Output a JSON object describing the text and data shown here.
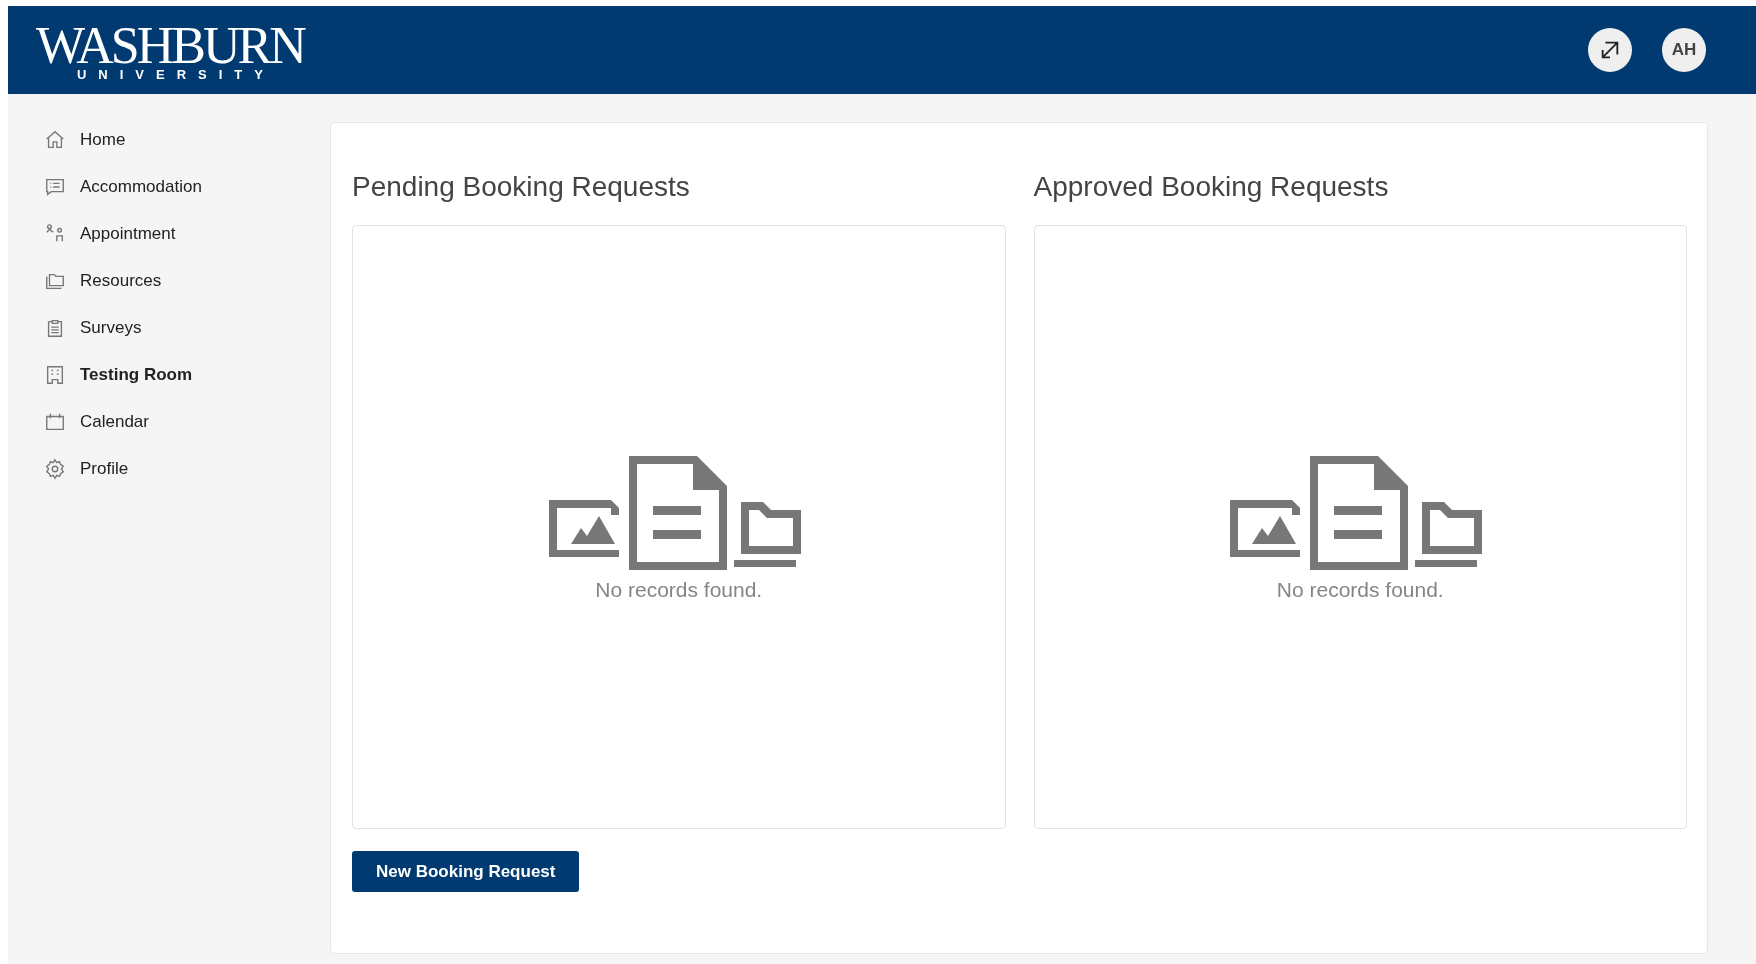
{
  "header": {
    "logo": {
      "name": "WASHBURN",
      "sub": "UNIVERSITY"
    },
    "avatar": "AH"
  },
  "sidebar": {
    "items": [
      {
        "label": "Home",
        "selected": false
      },
      {
        "label": "Accommodation",
        "selected": false
      },
      {
        "label": "Appointment",
        "selected": false
      },
      {
        "label": "Resources",
        "selected": false
      },
      {
        "label": "Surveys",
        "selected": false
      },
      {
        "label": "Testing Room",
        "selected": true
      },
      {
        "label": "Calendar",
        "selected": false
      },
      {
        "label": "Profile",
        "selected": false
      }
    ]
  },
  "panels": [
    {
      "title": "Pending Booking Requests",
      "empty_text": "No records found."
    },
    {
      "title": "Approved Booking Requests",
      "empty_text": "No records found."
    }
  ],
  "new_button": "New Booking Request"
}
